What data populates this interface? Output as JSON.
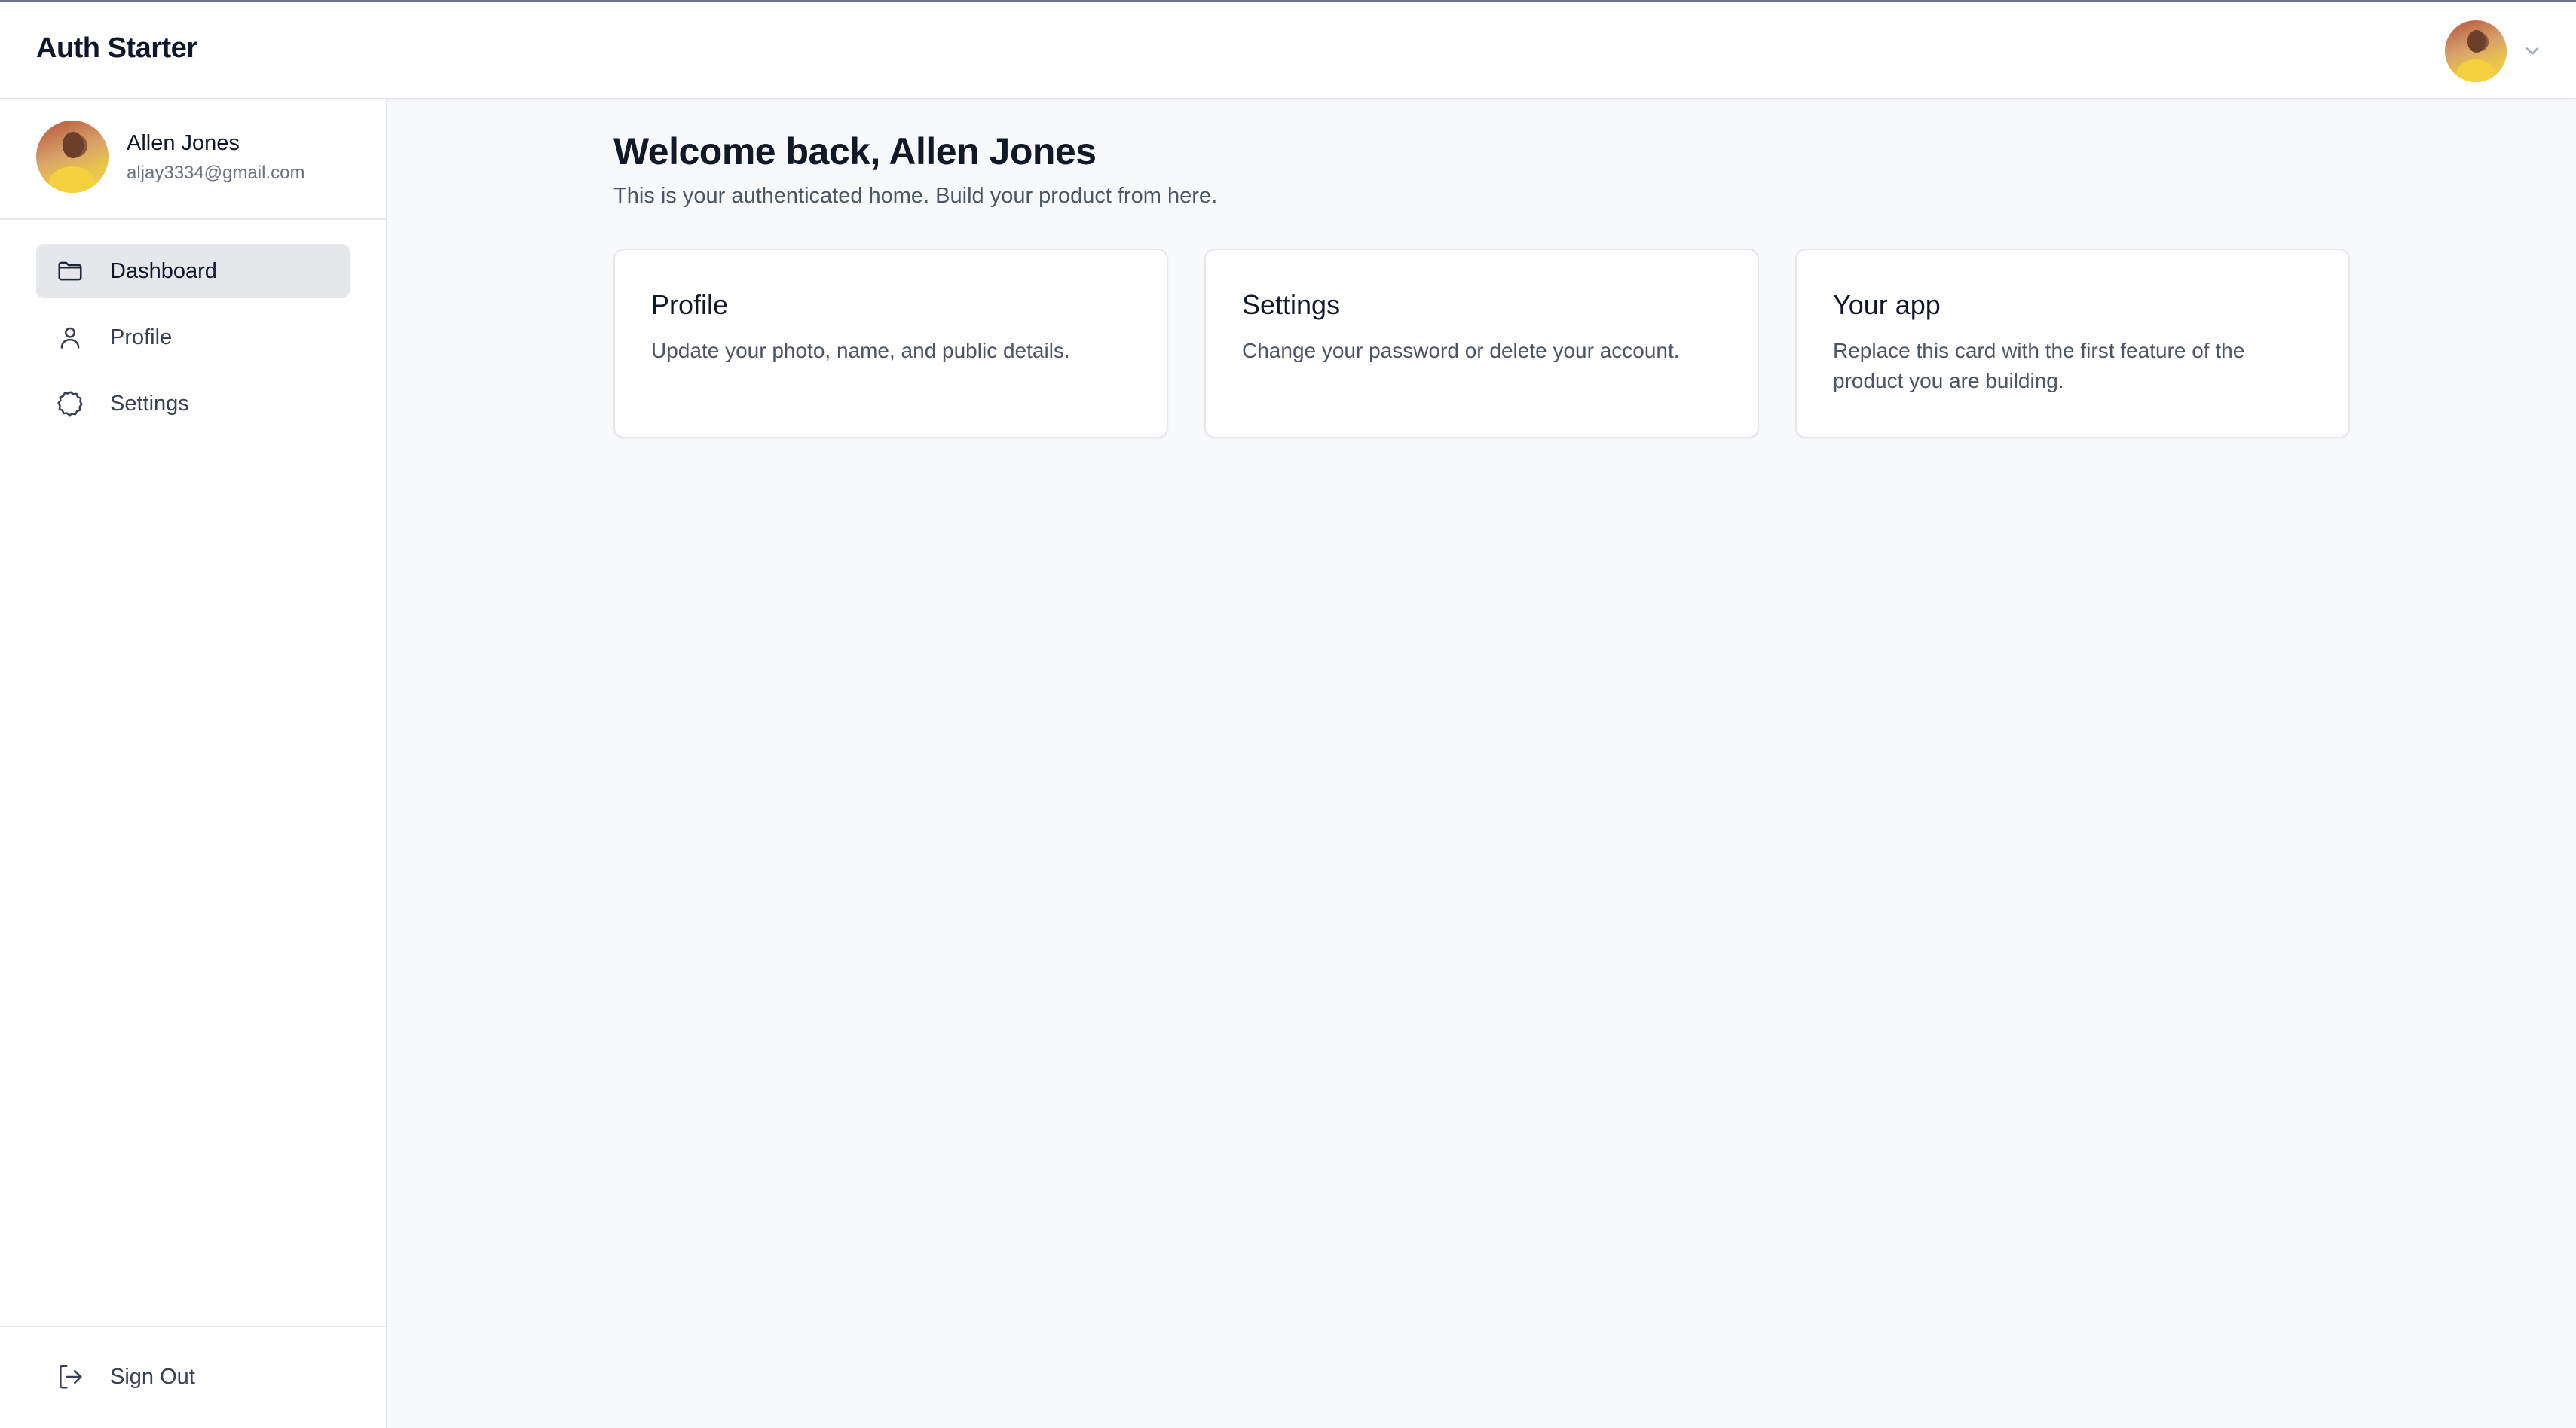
{
  "header": {
    "brand": "Auth Starter"
  },
  "sidebar": {
    "user": {
      "name": "Allen Jones",
      "email": "aljay3334@gmail.com"
    },
    "items": [
      {
        "label": "Dashboard",
        "icon": "folder-icon",
        "active": true
      },
      {
        "label": "Profile",
        "icon": "user-icon",
        "active": false
      },
      {
        "label": "Settings",
        "icon": "gear-icon",
        "active": false
      }
    ],
    "signout_label": "Sign Out"
  },
  "main": {
    "welcome": "Welcome back, Allen Jones",
    "subtitle": "This is your authenticated home. Build your product from here.",
    "cards": [
      {
        "title": "Profile",
        "description": "Update your photo, name, and public details."
      },
      {
        "title": "Settings",
        "description": "Change your password or delete your account."
      },
      {
        "title": "Your app",
        "description": "Replace this card with the first feature of the product you are building."
      }
    ]
  },
  "colors": {
    "background": "#f8f9fb",
    "active_nav": "#e5e7eb",
    "text_primary": "#0f172a",
    "text_muted": "#4b5563"
  }
}
